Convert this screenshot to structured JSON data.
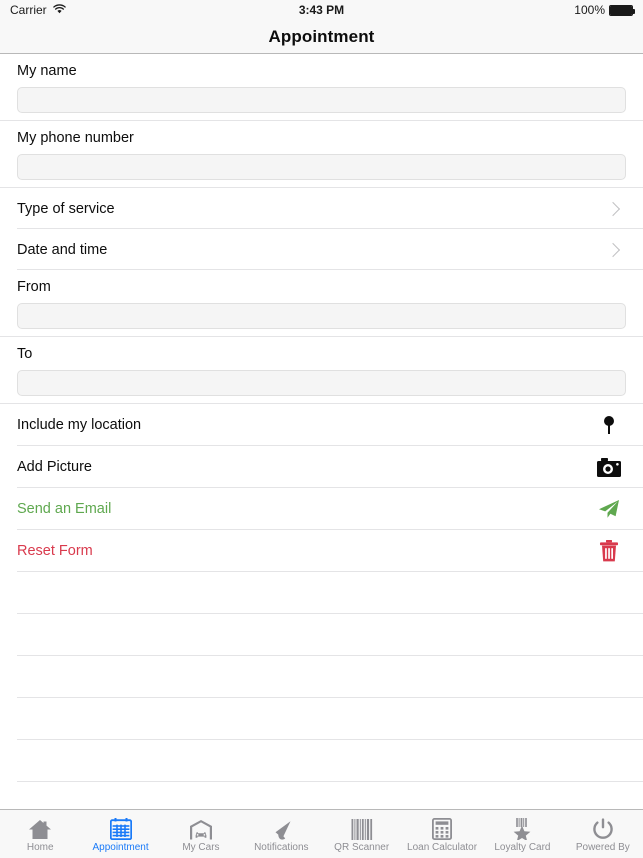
{
  "status_bar": {
    "carrier": "Carrier",
    "wifi_icon": "wifi-icon",
    "time": "3:43 PM",
    "battery_percent": "100%",
    "battery_icon": "battery-full-icon"
  },
  "navbar": {
    "title": "Appointment"
  },
  "form": {
    "fields": [
      {
        "label": "My name",
        "value": "",
        "placeholder": ""
      },
      {
        "label": "My phone number",
        "value": "",
        "placeholder": ""
      }
    ],
    "disclosures": [
      {
        "label": "Type of service",
        "icon": "chevron-right-icon"
      },
      {
        "label": "Date and time",
        "icon": "chevron-right-icon"
      }
    ],
    "range_fields": [
      {
        "label": "From",
        "value": "",
        "placeholder": ""
      },
      {
        "label": "To",
        "value": "",
        "placeholder": ""
      }
    ],
    "actions": [
      {
        "label": "Include my location",
        "icon": "location-pin-icon",
        "color": "#0d0d0d"
      },
      {
        "label": "Add Picture",
        "icon": "camera-icon",
        "color": "#0d0d0d"
      },
      {
        "label": "Send an Email",
        "icon": "paper-plane-icon",
        "color": "#5fa84f"
      },
      {
        "label": "Reset Form",
        "icon": "trash-icon",
        "color": "#d93a4d"
      }
    ],
    "blank_rows": 5
  },
  "tabbar": {
    "active_color": "#1a7af8",
    "inactive_color": "#8e8e93",
    "tabs": [
      {
        "label": "Home",
        "icon": "home-icon",
        "active": false
      },
      {
        "label": "Appointment",
        "icon": "calendar-icon",
        "active": true
      },
      {
        "label": "My Cars",
        "icon": "garage-car-icon",
        "active": false
      },
      {
        "label": "Notifications",
        "icon": "megaphone-icon",
        "active": false
      },
      {
        "label": "QR Scanner",
        "icon": "barcode-icon",
        "active": false
      },
      {
        "label": "Loan Calculator",
        "icon": "calculator-icon",
        "active": false
      },
      {
        "label": "Loyalty Card",
        "icon": "loyalty-star-icon",
        "active": false
      },
      {
        "label": "Powered By",
        "icon": "power-icon",
        "active": false
      }
    ]
  }
}
